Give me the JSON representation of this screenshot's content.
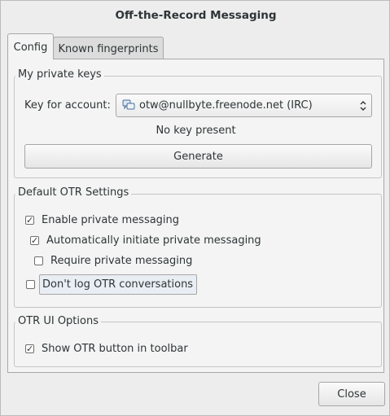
{
  "window": {
    "title": "Off-the-Record Messaging"
  },
  "tabs": [
    {
      "label": "Config",
      "selected": true
    },
    {
      "label": "Known fingerprints",
      "selected": false
    }
  ],
  "private_keys": {
    "heading": "My private keys",
    "account_label": "Key for account:",
    "account_value": "otw@nullbyte.freenode.net (IRC)",
    "account_icon": "chat-bubbles-icon",
    "status": "No key present",
    "generate_label": "Generate"
  },
  "default_settings": {
    "heading": "Default OTR Settings",
    "options": [
      {
        "label": "Enable private messaging",
        "checked": true
      },
      {
        "label": "Automatically initiate private messaging",
        "checked": true
      },
      {
        "label": "Require private messaging",
        "checked": false
      },
      {
        "label": "Don't log OTR conversations",
        "checked": false
      }
    ]
  },
  "ui_options": {
    "heading": "OTR UI Options",
    "options": [
      {
        "label": "Show OTR button in toolbar",
        "checked": true
      }
    ]
  },
  "footer": {
    "close_label": "Close"
  }
}
